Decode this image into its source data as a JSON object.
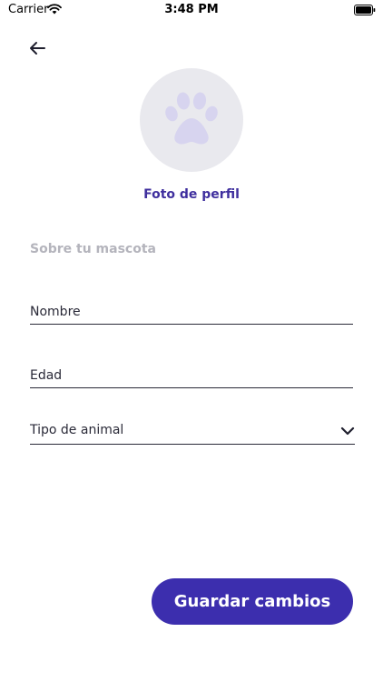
{
  "status_bar": {
    "carrier": "Carrier",
    "time": "3:48 PM"
  },
  "icons": {
    "back": "arrow-left-icon",
    "avatar": "paw-icon",
    "dropdown": "chevron-down-icon",
    "wifi": "wifi-icon",
    "battery": "battery-icon"
  },
  "profile": {
    "photo_label": "Foto de perfil"
  },
  "form": {
    "section_title": "Sobre tu mascota",
    "name_placeholder": "Nombre",
    "age_placeholder": "Edad",
    "type_placeholder": "Tipo de animal"
  },
  "actions": {
    "save_label": "Guardar cambios"
  },
  "colors": {
    "primary": "#3c2eae",
    "link": "#3f2f9e",
    "muted": "#b4b4bc",
    "avatar_bg": "#e9e9ee",
    "paw": "#d7d4ef"
  }
}
